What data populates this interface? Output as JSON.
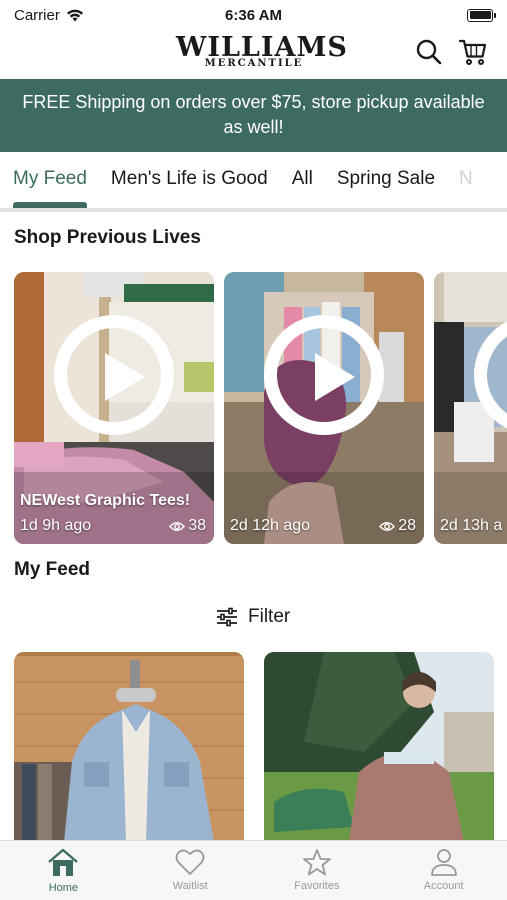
{
  "status_bar": {
    "carrier": "Carrier",
    "time": "6:36 AM"
  },
  "header": {
    "logo_main": "WILLIAMS",
    "logo_sub": "MERCANTILE"
  },
  "banner": {
    "text": "FREE Shipping on orders over $75, store pickup available as well!"
  },
  "tabs": [
    {
      "label": "My Feed",
      "active": true
    },
    {
      "label": "Men's Life is Good"
    },
    {
      "label": "All"
    },
    {
      "label": "Spring Sale"
    },
    {
      "label": "N"
    }
  ],
  "shop_previous_lives": {
    "title": "Shop Previous Lives",
    "cards": [
      {
        "title": "NEWest Graphic Tees!",
        "age": "1d 9h ago",
        "views": "38"
      },
      {
        "title": "",
        "age": "2d 12h ago",
        "views": "28"
      },
      {
        "title": "",
        "age": "2d 13h a",
        "views": ""
      }
    ]
  },
  "my_feed": {
    "title": "My Feed",
    "filter_label": "Filter"
  },
  "tabbar": [
    {
      "label": "Home",
      "icon": "home-icon",
      "active": true
    },
    {
      "label": "Waitlist",
      "icon": "heart-icon"
    },
    {
      "label": "Favorites",
      "icon": "star-icon"
    },
    {
      "label": "Account",
      "icon": "person-icon"
    }
  ],
  "colors": {
    "brand_green": "#3d6b62",
    "inactive_gray": "#9a9a9a"
  }
}
